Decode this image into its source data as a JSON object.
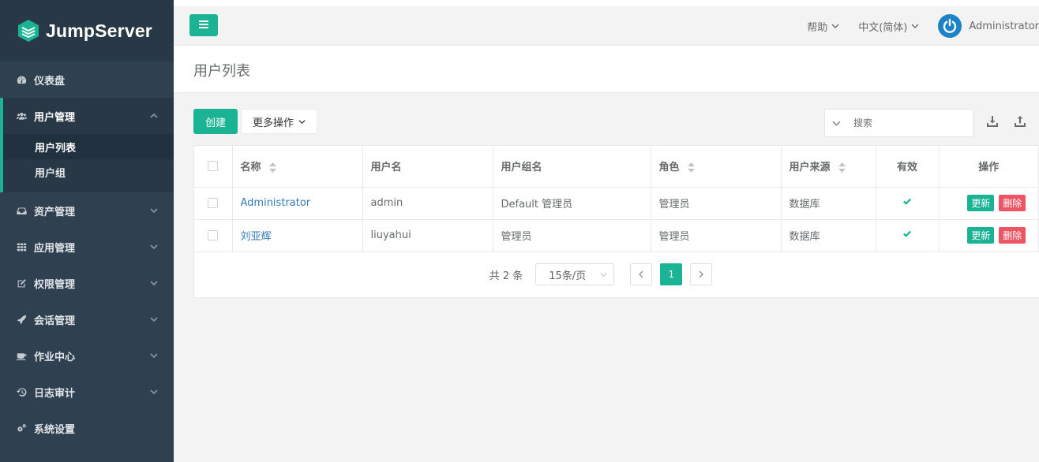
{
  "brand": {
    "name": "JumpServer",
    "logo_icon": "jumpserver-logo-icon"
  },
  "sidebar": {
    "items": [
      {
        "label": "仪表盘",
        "icon": "dashboard-icon"
      },
      {
        "label": "用户管理",
        "icon": "users-icon",
        "expanded": true,
        "children": [
          {
            "label": "用户列表",
            "active": true
          },
          {
            "label": "用户组"
          }
        ]
      },
      {
        "label": "资产管理",
        "icon": "inbox-icon"
      },
      {
        "label": "应用管理",
        "icon": "grid-icon"
      },
      {
        "label": "权限管理",
        "icon": "edit-icon"
      },
      {
        "label": "会话管理",
        "icon": "rocket-icon"
      },
      {
        "label": "作业中心",
        "icon": "coffee-icon"
      },
      {
        "label": "日志审计",
        "icon": "history-icon"
      },
      {
        "label": "系统设置",
        "icon": "gears-icon"
      }
    ]
  },
  "topbar": {
    "help": "帮助",
    "language": "中文(简体)",
    "user": "Administrator"
  },
  "page": {
    "title": "用户列表"
  },
  "toolbar": {
    "create_label": "创建",
    "more_label": "更多操作",
    "search_placeholder": "搜索"
  },
  "table": {
    "columns": [
      "名称",
      "用户名",
      "用户组名",
      "角色",
      "用户来源",
      "有效",
      "操作"
    ],
    "rows": [
      {
        "name": "Administrator",
        "username": "admin",
        "groups": "Default 管理员",
        "role": "管理员",
        "source": "数据库",
        "valid": true,
        "update": "更新",
        "delete": "删除"
      },
      {
        "name": "刘亚辉",
        "username": "liuyahui",
        "groups": "管理员",
        "role": "管理员",
        "source": "数据库",
        "valid": true,
        "update": "更新",
        "delete": "删除"
      }
    ]
  },
  "pagination": {
    "total": "共 2 条",
    "page_size": "15条/页",
    "current_page": "1"
  },
  "colors": {
    "accent": "#1ab394",
    "sidebar_bg": "#2f4050",
    "danger": "#ed5565",
    "link": "#337ab7"
  }
}
